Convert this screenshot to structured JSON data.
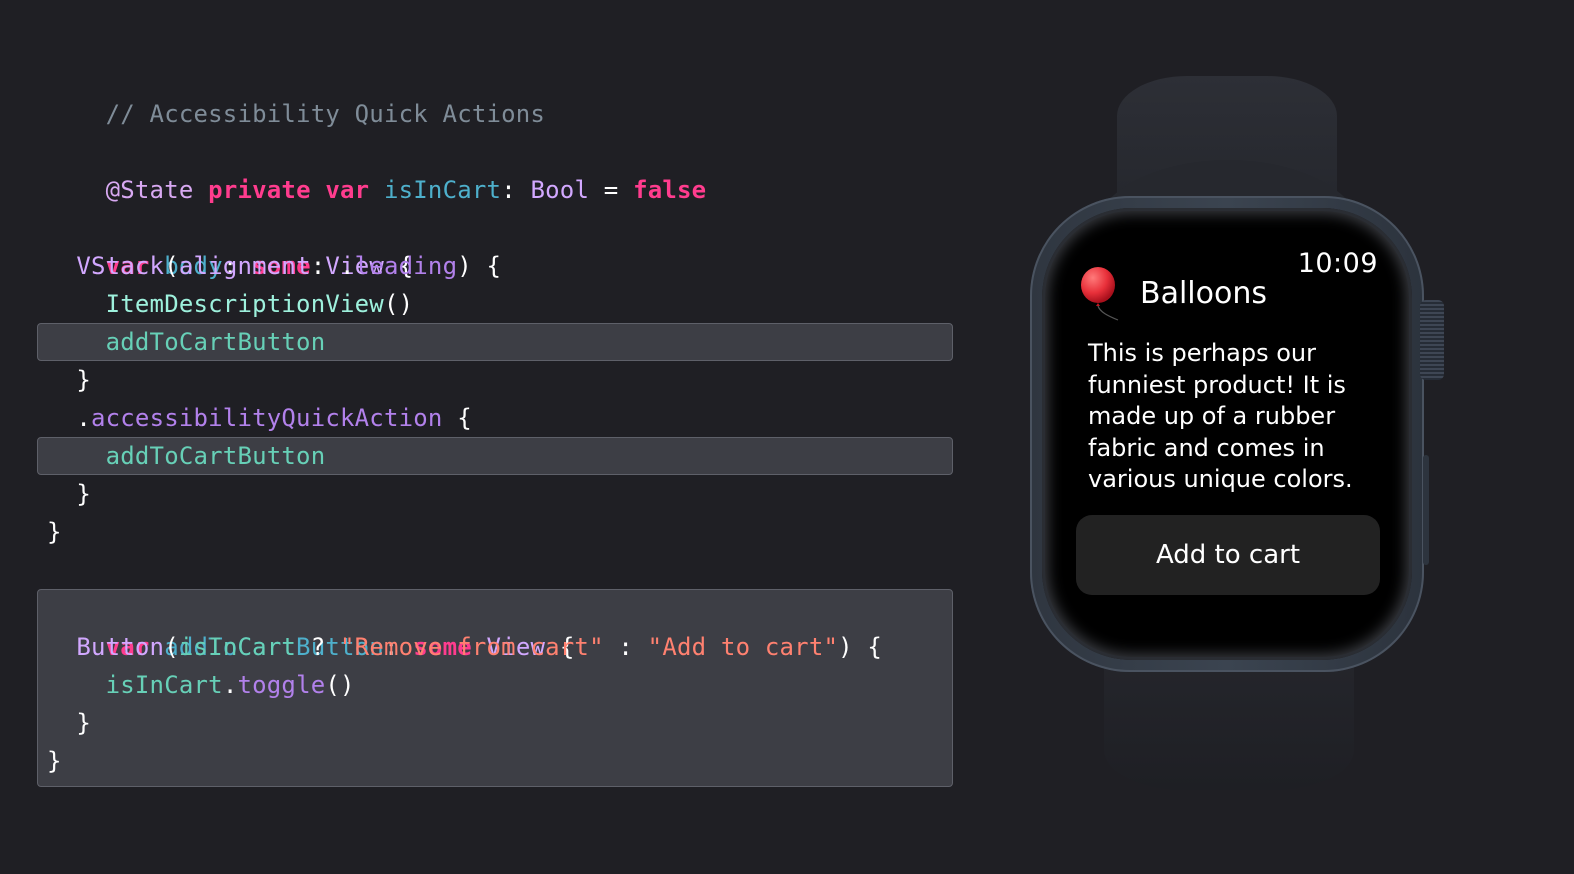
{
  "code": {
    "comment": "// Accessibility Quick Actions",
    "state_line": {
      "attr": "@State",
      "kw_private": "private",
      "kw_var": "var",
      "name": "isInCart",
      "colon": ":",
      "type": "Bool",
      "eq": "=",
      "value": "false"
    },
    "body_decl": {
      "kw_var": "var",
      "name": "body",
      "colon": ":",
      "kw_some": "some",
      "type": "View",
      "brace": "{"
    },
    "vstack": {
      "name": "VStack",
      "open": "(",
      "arg": "alignment",
      "colon": ": .",
      "value": "leading",
      "close": ") {"
    },
    "item_description": {
      "name": "ItemDescriptionView",
      "parens": "()"
    },
    "add_to_cart_ref_1": "addToCartButton",
    "close_brace_1": "}",
    "quick_action": {
      "dot": ".",
      "name": "accessibilityQuickAction",
      "brace": " {"
    },
    "add_to_cart_ref_2": "addToCartButton",
    "close_brace_2": "}",
    "close_brace_3": "}",
    "button_decl": {
      "kw_var": "var",
      "name": "addToCartButton",
      "colon": ":",
      "kw_some": "some",
      "type": "View",
      "brace": "{"
    },
    "button_line": {
      "name": "Button",
      "open": "(",
      "cond": "isInCart",
      "q": " ? ",
      "str_true": "\"Remove from cart\"",
      "sep": " : ",
      "str_false": "\"Add to cart\"",
      "close": ") {"
    },
    "toggle_line": {
      "target": "isInCart",
      "dot": ".",
      "method": "toggle",
      "parens": "()"
    },
    "close_brace_4": "}",
    "close_brace_5": "}"
  },
  "watch": {
    "time": "10:09",
    "icon": "balloon-emoji",
    "title": "Balloons",
    "description": "This is perhaps our funniest product! It is made up of a rubber fabric and comes in various unique colors.",
    "button_label": "Add to cart"
  },
  "colors": {
    "background": "#1f1f24",
    "keyword": "#ff3c8e",
    "declaration": "#4eb0cc",
    "type": "#d2a8ff",
    "string": "#ff8170",
    "identifier": "#67d0b7",
    "comment": "#7f8c98",
    "highlight": "#3d3e45"
  }
}
